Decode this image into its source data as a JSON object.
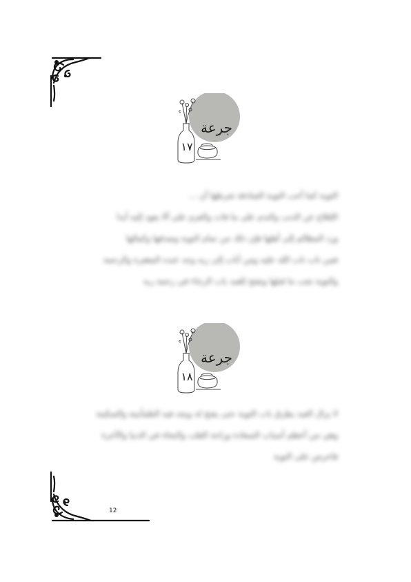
{
  "sections": [
    {
      "badge_word": "جرعة",
      "badge_number": "١٧",
      "lines": [
        "التوبة كما أحب التوبة الصادقة شرطها أن ...",
        "الإقلاع عن الذنب والندم على ما فات والعزم على ألا يعود إليه أبدا",
        "ورد المظالم إلى أهلها فإن ذلك من تمام التوبة وصدقها وكمالها",
        "فمن تاب تاب الله عليه ومن أناب إلى ربه وجد عنده المغفرة والرحمة",
        "والتوبة تجب ما قبلها وتفتح للعبد باب الرجاء في رحمة ربه"
      ]
    },
    {
      "badge_word": "جرعة",
      "badge_number": "١٨",
      "lines": [
        "لا يزال العبد يطرق باب التوبة حتى يفتح له ويجد فيه الطمأنينة والسكينة",
        "وهي من أعظم أسباب السعادة وراحة القلب والنجاة في الدنيا والآخرة",
        "فاحرص على التوبة"
      ]
    }
  ],
  "page_number": "12"
}
